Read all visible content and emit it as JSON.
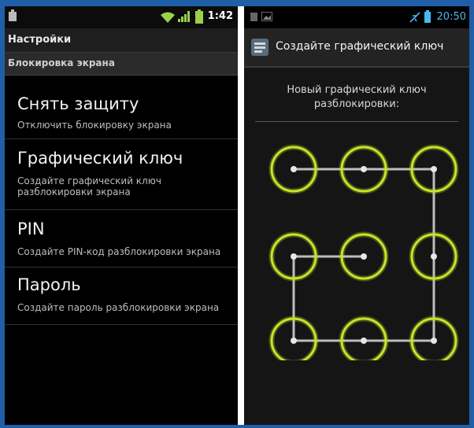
{
  "left_screen": {
    "status_bar": {
      "time": "1:42"
    },
    "title": "Настройки",
    "section": "Блокировка экрана",
    "items": [
      {
        "title": "Снять защиту",
        "subtitle": "Отключить блокировку экрана"
      },
      {
        "title": "Графический ключ",
        "subtitle_line1": "Создайте графический ключ",
        "subtitle_line2": "разблокировки экрана"
      },
      {
        "title": "PIN",
        "subtitle": "Создайте PIN-код разблокировки экрана"
      },
      {
        "title": "Пароль",
        "subtitle": "Создайте пароль разблокировки экрана"
      }
    ]
  },
  "right_screen": {
    "status_bar": {
      "time": "20:50"
    },
    "action_bar_title": "Создайте графический ключ",
    "prompt_line1": "Новый графический ключ",
    "prompt_line2": "разблокировки:",
    "pattern": {
      "grid": "3x3",
      "sequence": [
        1,
        2,
        3,
        6,
        9,
        8,
        7,
        4,
        5
      ],
      "ring_color": "#c4e628",
      "line_color": "#bdbdbd"
    }
  },
  "colors": {
    "page_border": "#1f5fa8",
    "status_time_right": "#49b8f0",
    "divider": "#ffffff"
  }
}
